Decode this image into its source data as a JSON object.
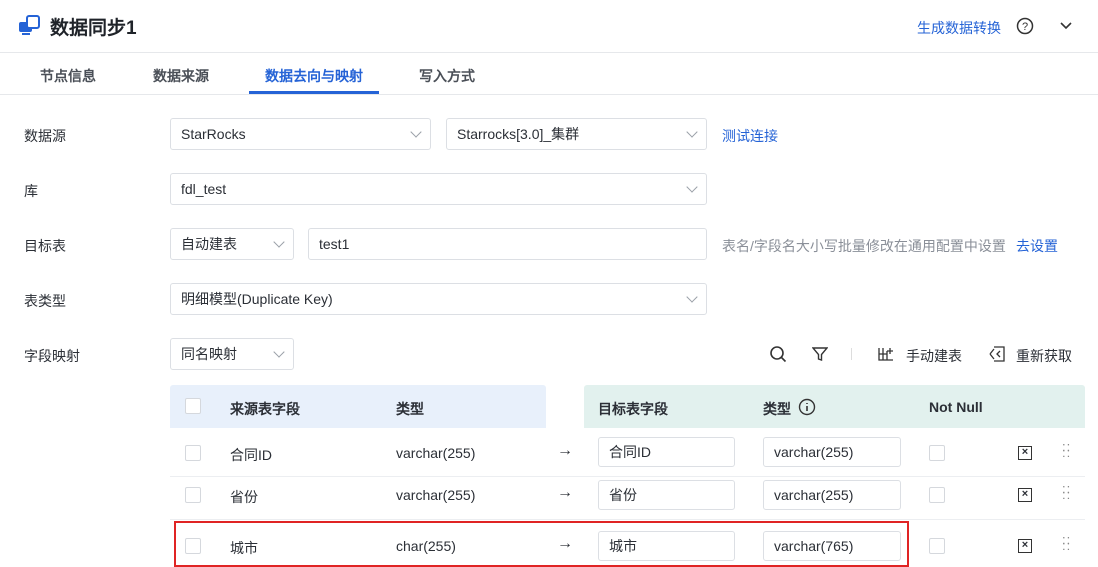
{
  "header": {
    "title": "数据同步1",
    "generate_link": "生成数据转换"
  },
  "tabs": [
    {
      "label": "节点信息"
    },
    {
      "label": "数据来源"
    },
    {
      "label": "数据去向与映射"
    },
    {
      "label": "写入方式"
    }
  ],
  "form": {
    "datasource": {
      "label": "数据源",
      "type": "StarRocks",
      "connection": "Starrocks[3.0]_集群",
      "test_link": "测试连接"
    },
    "database": {
      "label": "库",
      "value": "fdl_test"
    },
    "target_table": {
      "label": "目标表",
      "mode": "自动建表",
      "value": "test1",
      "hint": "表名/字段名大小写批量修改在通用配置中设置",
      "settings_link": "去设置"
    },
    "table_type": {
      "label": "表类型",
      "value": "明细模型(Duplicate Key)"
    },
    "field_mapping": {
      "label": "字段映射",
      "mode": "同名映射",
      "manual_create": "手动建表",
      "refetch": "重新获取"
    }
  },
  "table": {
    "source_headers": [
      "来源表字段",
      "类型"
    ],
    "target_headers": [
      "目标表字段",
      "类型",
      "Not Null"
    ],
    "rows": [
      {
        "src": "合同ID",
        "src_type": "varchar(255)",
        "dst": "合同ID",
        "dst_type": "varchar(255)"
      },
      {
        "src": "省份",
        "src_type": "varchar(255)",
        "dst": "省份",
        "dst_type": "varchar(255)"
      },
      {
        "src": "城市",
        "src_type": "char(255)",
        "dst": "城市",
        "dst_type": "varchar(765)"
      }
    ]
  }
}
